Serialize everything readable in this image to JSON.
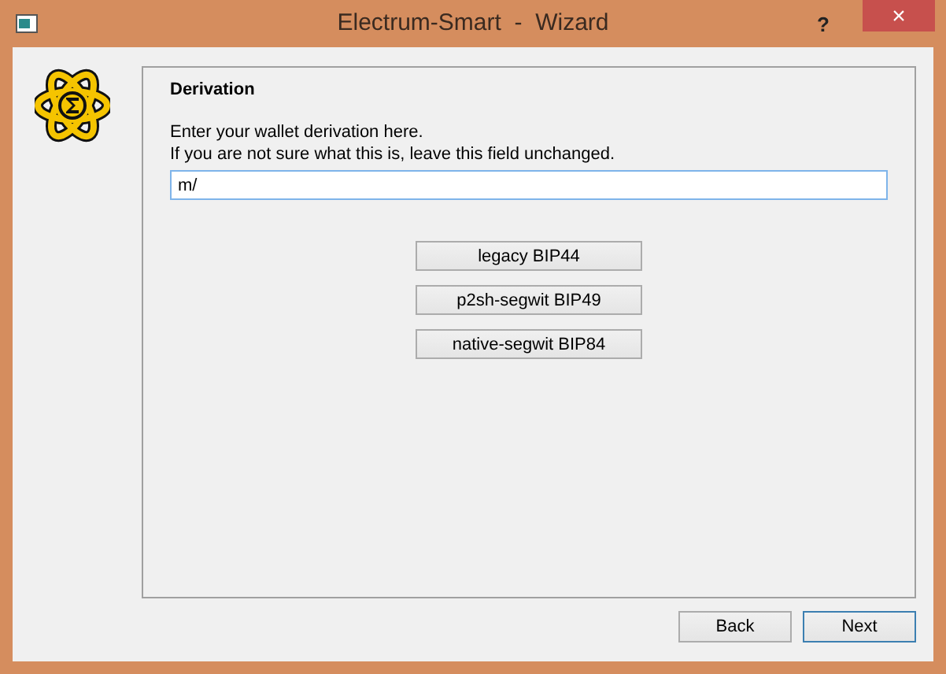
{
  "window": {
    "title": "Electrum-Smart  -  Wizard",
    "help": "?",
    "close": "×"
  },
  "page": {
    "heading": "Derivation",
    "lines": [
      "Enter your wallet derivation here.",
      "If you are not sure what this is, leave this field unchanged."
    ],
    "field": {
      "value": "m/"
    },
    "options": [
      "legacy BIP44",
      "p2sh-segwit BIP49",
      "native-segwit BIP84"
    ]
  },
  "buttons": [
    {
      "label": "Back",
      "default": false
    },
    {
      "label": "Next",
      "default": true
    }
  ]
}
